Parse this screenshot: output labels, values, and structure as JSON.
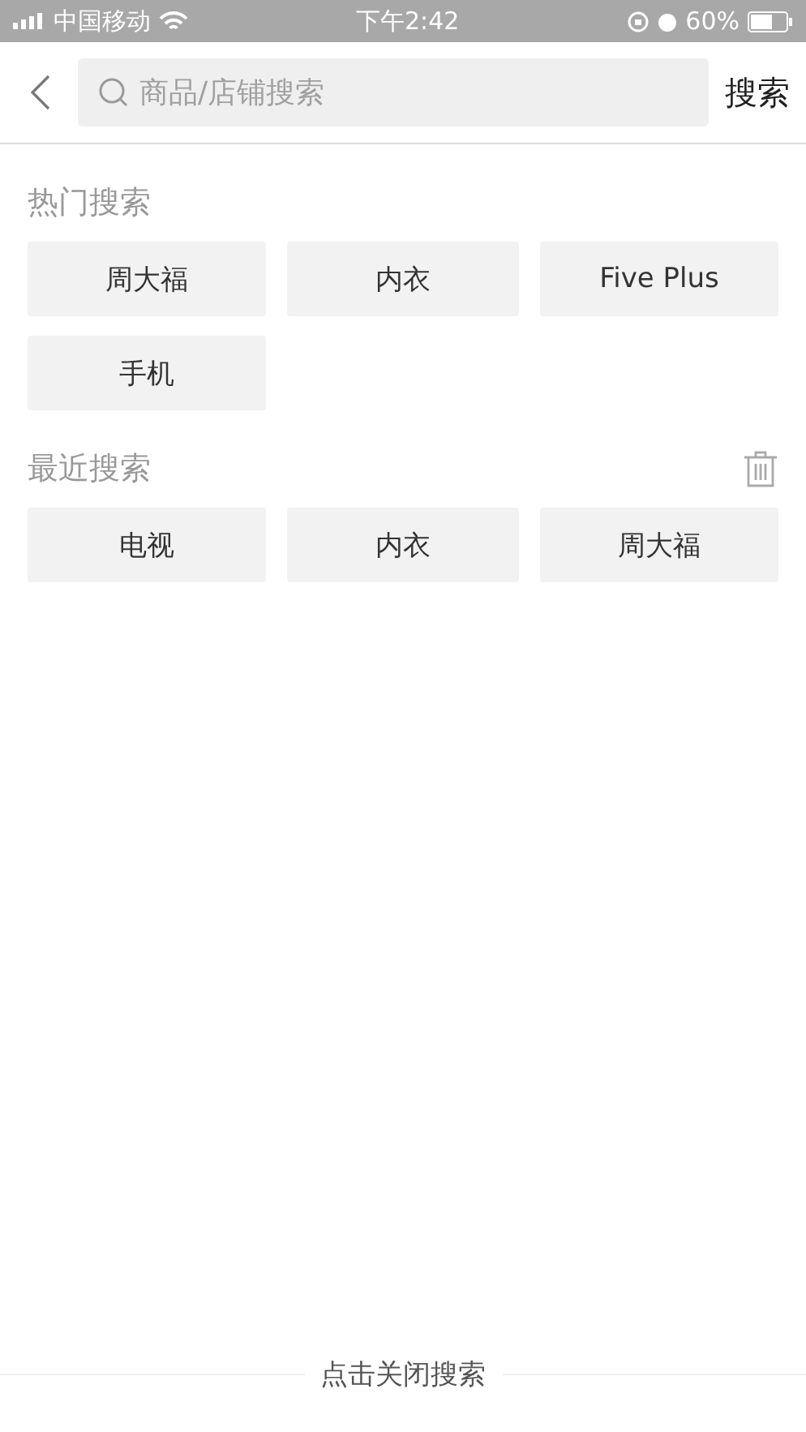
{
  "status_bar": {
    "carrier": "中国移动",
    "time": "下午2:42",
    "battery": "60%"
  },
  "header": {
    "search": {
      "placeholder": "商品/店铺搜索"
    },
    "search_button": "搜索"
  },
  "hot_searches": {
    "title": "热门搜索",
    "tags": [
      "周大福",
      "内衣",
      "Five Plus",
      "手机"
    ]
  },
  "recent_searches": {
    "title": "最近搜索",
    "tags": [
      "电视",
      "内衣",
      "周大福"
    ]
  },
  "footer": {
    "close_label": "点击关闭搜索"
  }
}
